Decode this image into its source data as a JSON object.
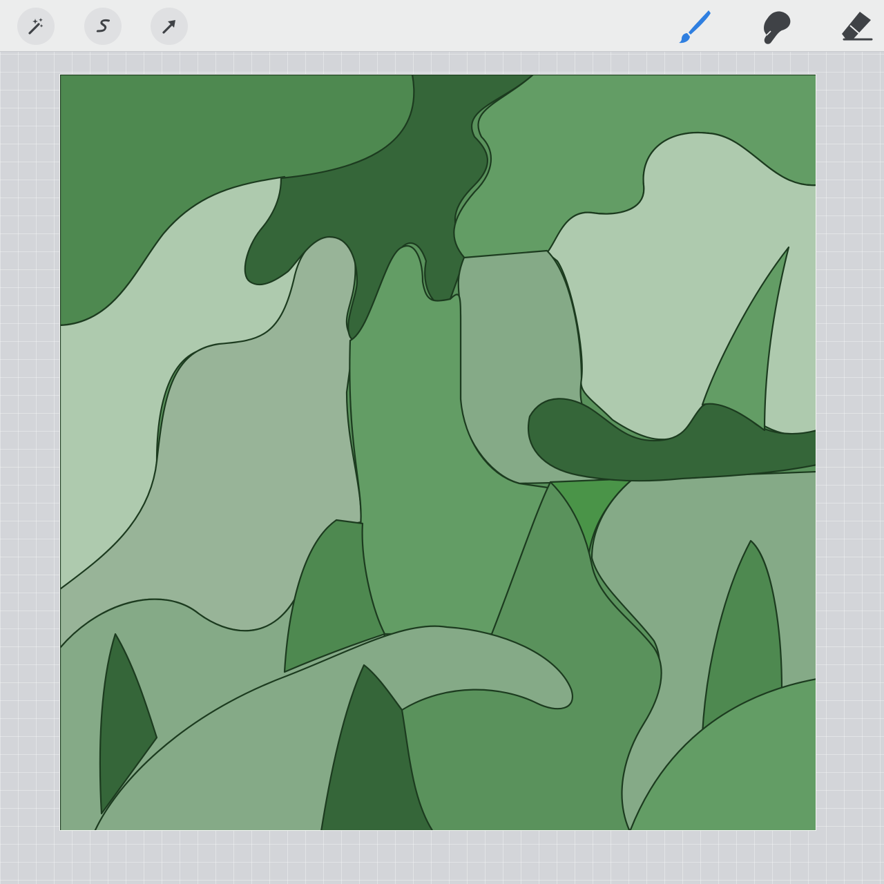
{
  "app": "drawing-canvas",
  "toolbar": {
    "left_tools": [
      {
        "name": "adjustments",
        "icon": "magic-wand-icon"
      },
      {
        "name": "selection",
        "icon": "selection-s-icon"
      },
      {
        "name": "transform",
        "icon": "arrow-cursor-icon"
      }
    ],
    "right_tools": [
      {
        "name": "brush",
        "icon": "brush-icon",
        "active": true
      },
      {
        "name": "smudge",
        "icon": "smudge-finger-icon",
        "active": false
      },
      {
        "name": "eraser",
        "icon": "eraser-icon",
        "active": false
      }
    ],
    "active_color": "#2f7fe0",
    "icon_color": "#3f4246"
  },
  "artwork": {
    "palette": {
      "darkest": "#356639",
      "dark": "#4e8950",
      "medium": "#639d65",
      "pale": "#aecaae",
      "sage": "#98b498",
      "muted": "#85aa87",
      "bright": "#4a9448",
      "mid2": "#5a925c",
      "outline": "#1c3b1f"
    }
  }
}
